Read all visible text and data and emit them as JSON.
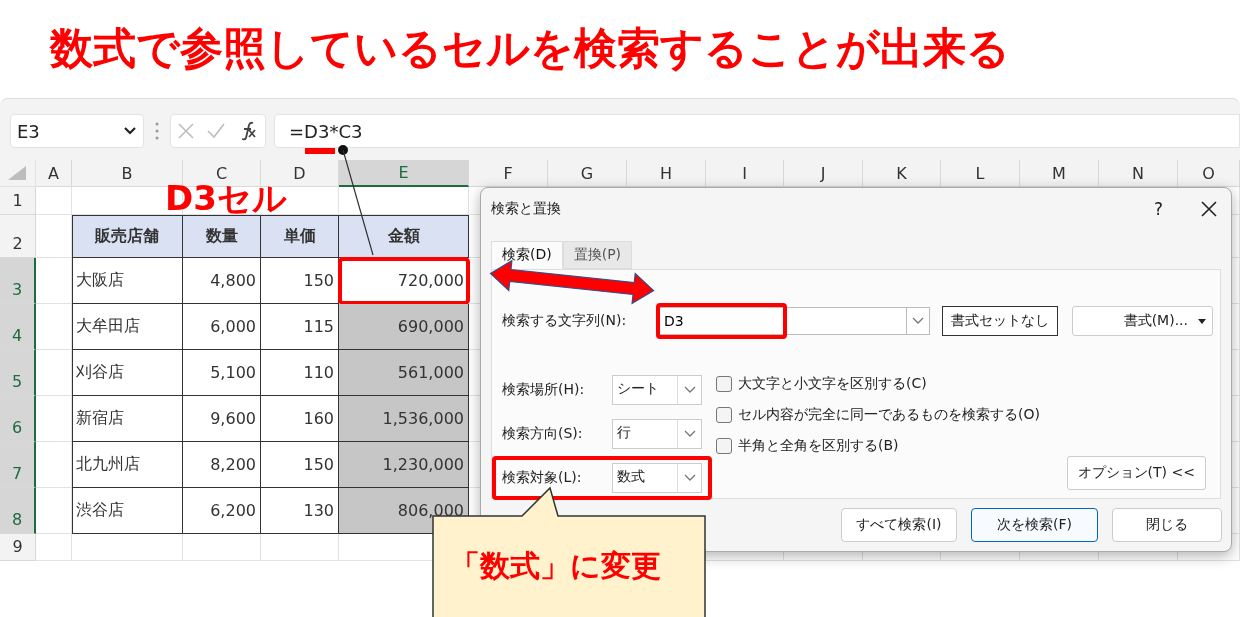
{
  "banner": {
    "title": "数式で参照しているセルを検索することが出来る"
  },
  "name_box": {
    "value": "E3"
  },
  "formula_bar": {
    "value": "=D3*C3"
  },
  "annotations": {
    "cell_label": "D3セル",
    "callout": "「数式」に変更"
  },
  "sheet": {
    "columns": [
      {
        "label": "A",
        "selected": false
      },
      {
        "label": "B",
        "selected": false
      },
      {
        "label": "C",
        "selected": false
      },
      {
        "label": "D",
        "selected": false
      },
      {
        "label": "E",
        "selected": true
      },
      {
        "label": "F",
        "selected": false
      },
      {
        "label": "G",
        "selected": false
      },
      {
        "label": "H",
        "selected": false
      },
      {
        "label": "I",
        "selected": false
      },
      {
        "label": "J",
        "selected": false
      },
      {
        "label": "K",
        "selected": false
      },
      {
        "label": "L",
        "selected": false
      },
      {
        "label": "M",
        "selected": false
      },
      {
        "label": "N",
        "selected": false
      },
      {
        "label": "O",
        "selected": false
      }
    ],
    "rows": [
      {
        "label": "1",
        "selected": false
      },
      {
        "label": "2",
        "selected": false
      },
      {
        "label": "3",
        "selected": true
      },
      {
        "label": "4",
        "selected": true
      },
      {
        "label": "5",
        "selected": true
      },
      {
        "label": "6",
        "selected": true
      },
      {
        "label": "7",
        "selected": true
      },
      {
        "label": "8",
        "selected": true
      },
      {
        "label": "9",
        "selected": false
      }
    ]
  },
  "table": {
    "columns": [
      "販売店舗",
      "数量",
      "単価",
      "金額"
    ],
    "rows": [
      {
        "store": "大阪店",
        "quantity": "4,800",
        "price": "150",
        "amount": "720,000",
        "amount_selected": false,
        "highlighted": true
      },
      {
        "store": "大牟田店",
        "quantity": "6,000",
        "price": "115",
        "amount": "690,000",
        "amount_selected": true,
        "highlighted": false
      },
      {
        "store": "刈谷店",
        "quantity": "5,100",
        "price": "110",
        "amount": "561,000",
        "amount_selected": true,
        "highlighted": false
      },
      {
        "store": "新宿店",
        "quantity": "9,600",
        "price": "160",
        "amount": "1,536,000",
        "amount_selected": true,
        "highlighted": false
      },
      {
        "store": "北九州店",
        "quantity": "8,200",
        "price": "150",
        "amount": "1,230,000",
        "amount_selected": true,
        "highlighted": false
      },
      {
        "store": "渋谷店",
        "quantity": "6,200",
        "price": "130",
        "amount": "806,000",
        "amount_selected": true,
        "highlighted": false
      }
    ]
  },
  "dialog": {
    "title": "検索と置換",
    "help": "?",
    "tabs": [
      {
        "label": "検索(D)",
        "selected": true
      },
      {
        "label": "置換(P)",
        "selected": false
      }
    ],
    "find": {
      "label": "検索する文字列(N):",
      "value": "D3",
      "highlighted": true
    },
    "format_buttons": [
      "書式セットなし",
      "書式(M)..."
    ],
    "selects": [
      {
        "label": "検索場所(H):",
        "value": "シート",
        "highlighted": false
      },
      {
        "label": "検索方向(S):",
        "value": "行",
        "highlighted": false
      },
      {
        "label": "検索対象(L):",
        "value": "数式",
        "highlighted": true
      }
    ],
    "checkboxes": [
      {
        "label": "大文字と小文字を区別する(C)",
        "checked": false
      },
      {
        "label": "セル内容が完全に同一であるものを検索する(O)",
        "checked": false
      },
      {
        "label": "半角と全角を区別する(B)",
        "checked": false
      }
    ],
    "options_button": "オプション(T) <<",
    "buttons": [
      {
        "label": "すべて検索(I)",
        "default": false
      },
      {
        "label": "次を検索(F)",
        "default": true
      },
      {
        "label": "閉じる",
        "default": false
      }
    ]
  }
}
